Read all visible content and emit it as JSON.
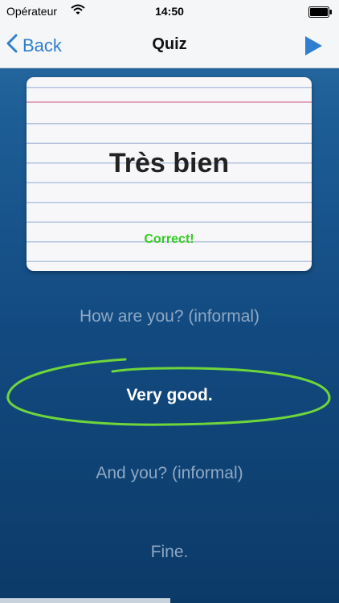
{
  "status_bar": {
    "carrier": "Opérateur",
    "time": "14:50"
  },
  "nav": {
    "back_label": "Back",
    "title": "Quiz"
  },
  "card": {
    "word": "Très bien",
    "status": "Correct!"
  },
  "answers": [
    {
      "label": "How are you? (informal)",
      "selected": false
    },
    {
      "label": "Very good.",
      "selected": true
    },
    {
      "label": "And you? (informal)",
      "selected": false
    },
    {
      "label": "Fine.",
      "selected": false
    }
  ],
  "colors": {
    "accent": "#2f7fd0",
    "correct": "#33cc22",
    "highlight": "#6fd63a",
    "answer_text": "#8fa8c4"
  },
  "icons": {
    "wifi": "wifi-icon",
    "battery": "battery-icon",
    "back": "chevron-left-icon",
    "play": "play-icon"
  }
}
